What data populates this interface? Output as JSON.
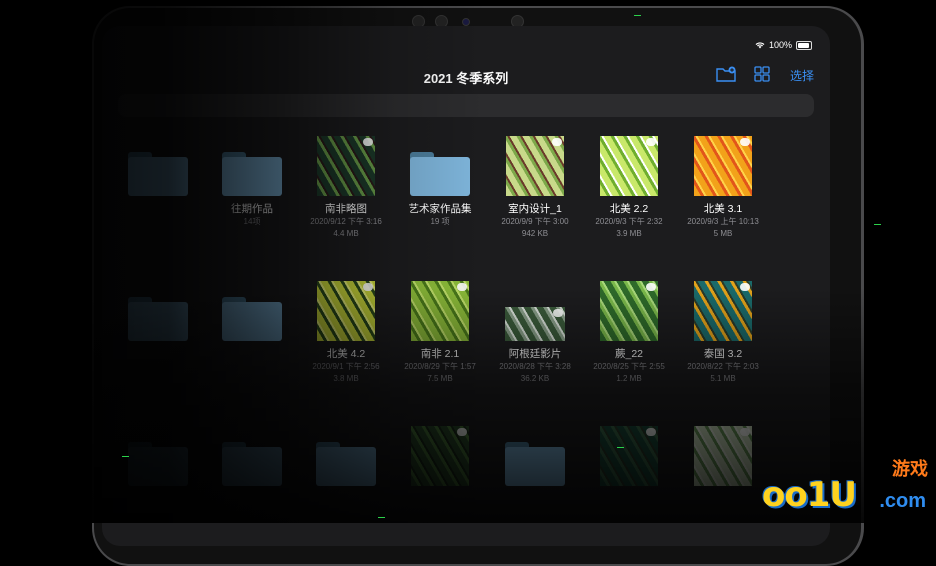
{
  "status": {
    "battery": "100%"
  },
  "nav": {
    "title": "2021 冬季系列",
    "select_label": "选择"
  },
  "icons": {
    "new_folder": "folder-plus-icon",
    "grid": "grid-view-icon",
    "cloud": "icloud-download-icon"
  },
  "colors": {
    "accent": "#3a8ff3",
    "folder": "#7fb6dc",
    "background": "#1c1c1e"
  },
  "row1": [
    {
      "name": "",
      "line1": "",
      "line2": "",
      "kind": "folder"
    },
    {
      "name": "往期作品",
      "line1": "14项",
      "line2": "",
      "kind": "folder"
    },
    {
      "name": "南非略图",
      "line1": "2020/9/12 下午 3:16",
      "line2": "4.4 MB",
      "kind": "image",
      "palette": [
        "#1c3a2a",
        "#6a9e4a",
        "#2a1a1a"
      ]
    },
    {
      "name": "艺术家作品集",
      "line1": "19 项",
      "line2": "",
      "kind": "folder"
    },
    {
      "name": "室内设计_1",
      "line1": "2020/9/9 下午 3:00",
      "line2": "942 KB",
      "kind": "image",
      "palette": [
        "#c8d98a",
        "#7da94a",
        "#6b3a2a"
      ]
    },
    {
      "name": "北美 2.2",
      "line1": "2020/9/3 下午 2:32",
      "line2": "3.9 MB",
      "kind": "image",
      "palette": [
        "#c9e86a",
        "#6fae2e",
        "#ffffff"
      ]
    },
    {
      "name": "北美 3.1",
      "line1": "2020/9/3 上午 10:13",
      "line2": "5 MB",
      "kind": "image",
      "palette": [
        "#f2a21a",
        "#e2561a",
        "#ffd34a"
      ]
    }
  ],
  "row2": [
    {
      "name": "",
      "line1": "",
      "line2": "",
      "kind": "folder"
    },
    {
      "name": "",
      "line1": "",
      "line2": "",
      "kind": "folder"
    },
    {
      "name": "北美 4.2",
      "line1": "2020/9/1 下午 2:56",
      "line2": "3.8 MB",
      "kind": "image",
      "palette": [
        "#c8d63a",
        "#2a4a1a",
        "#e8f07a"
      ]
    },
    {
      "name": "南非 2.1",
      "line1": "2020/8/29 下午 1:57",
      "line2": "7.5 MB",
      "kind": "image",
      "palette": [
        "#8dbd3a",
        "#4a7a1a",
        "#c0e06a"
      ]
    },
    {
      "name": "阿根廷影片",
      "line1": "2020/8/28 下午 3:28",
      "line2": "36.2 KB",
      "kind": "image",
      "palette": [
        "#3a5a3a",
        "#8aa08a",
        "#d8e0d8"
      ]
    },
    {
      "name": "蕨_22",
      "line1": "2020/8/25 下午 2:55",
      "line2": "1.2 MB",
      "kind": "image",
      "palette": [
        "#2e6a2a",
        "#7ab84a",
        "#a8d87a"
      ]
    },
    {
      "name": "泰国 3.2",
      "line1": "2020/8/22 下午 2:03",
      "line2": "5.1 MB",
      "kind": "image",
      "palette": [
        "#1a6a6a",
        "#e2a21a",
        "#2a3a2a"
      ]
    }
  ],
  "row3": [
    {
      "name": "",
      "line1": "",
      "line2": "",
      "kind": "folder"
    },
    {
      "name": "",
      "line1": "",
      "line2": "",
      "kind": "folder"
    },
    {
      "name": "",
      "line1": "",
      "line2": "",
      "kind": "folder"
    },
    {
      "name": "",
      "line1": "",
      "line2": "",
      "kind": "image",
      "palette": [
        "#2a4a2a",
        "#4a7a3a",
        "#1a2a1a"
      ]
    },
    {
      "name": "",
      "line1": "",
      "line2": "",
      "kind": "folder"
    },
    {
      "name": "",
      "line1": "",
      "line2": "",
      "kind": "image",
      "palette": [
        "#1a4a3a",
        "#3a6a4a",
        "#2a3a2a"
      ]
    },
    {
      "name": "",
      "line1": "",
      "line2": "",
      "kind": "image",
      "palette": [
        "#cfe0c0",
        "#6a9a5a",
        "#e8efe0"
      ]
    }
  ],
  "watermark": {
    "main": "oo1U",
    "sub": "游戏",
    "domain": ".com"
  }
}
